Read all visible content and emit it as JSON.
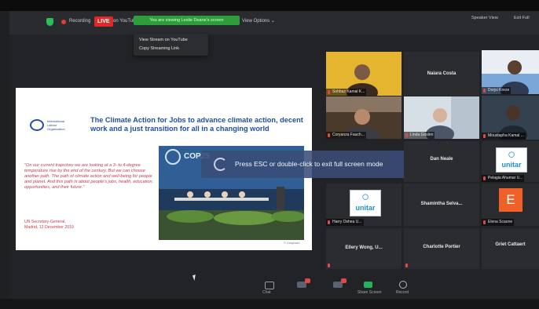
{
  "top_bar": {
    "recording_label": "Recording",
    "live_badge": "LIVE",
    "live_on": "on YouTube",
    "share_banner": "You are viewing Leslie Deane's screen",
    "view_options": "View Options ⌄",
    "speaker_view": "Speaker View",
    "exit_full_screen": "Exit Full"
  },
  "dropdown_menu": {
    "items": [
      "View Stream on YouTube",
      "Copy Streaming Link"
    ]
  },
  "slide": {
    "org_name": "International Labour Organization",
    "title": "The Climate Action for Jobs to advance climate action, decent work and a just transition for all in a changing world",
    "quote": "\"On our current trajectory we are looking at a 3- to 4-degree temperature rise by the end of the century. But we can choose another path. The path of climate action and well-being for people and planet. And this path is about people's jobs, health, education, opportunities, and their future.\"",
    "quote_cite": "UN Secretary-General, Madrid, 12 December 2019",
    "photo_banner": "COP25",
    "photo_caption": "© Unsplash"
  },
  "fullscreen_notice": {
    "text": "Press ESC or double-click to exit full screen mode"
  },
  "participants": [
    {
      "name": "Sohbaz Kamal K...",
      "kind": "video"
    },
    {
      "name": "Naiara Costa",
      "kind": "name"
    },
    {
      "name": "Dorjsi Kreze",
      "kind": "video"
    },
    {
      "name": "Coryanza Fauch...",
      "kind": "video"
    },
    {
      "name": "Linda Goslen",
      "kind": "video"
    },
    {
      "name": "Moustapha Kamal ...",
      "kind": "video"
    },
    {
      "name": "Dan Neale",
      "kind": "name"
    },
    {
      "name": "Pelagia Ahumar U...",
      "kind": "unitar"
    },
    {
      "name": "Harry Oshea U...",
      "kind": "unitar"
    },
    {
      "name": "Shamintha Selva...",
      "kind": "name"
    },
    {
      "name": "Elena Scaone",
      "kind": "letter",
      "letter": "E"
    },
    {
      "name": "Ellery Wong, U...",
      "kind": "name"
    },
    {
      "name": "Charlotte Portier",
      "kind": "name"
    },
    {
      "name": "Griet Cattaert",
      "kind": "name"
    }
  ],
  "unitar_logo": "unitar",
  "toolbar": {
    "share": "Chat",
    "reactions": "Reactions",
    "share_screen": "Share Screen",
    "record": "Record"
  },
  "colors": {
    "live_red": "#e02828",
    "banner_green": "#2e9e3c",
    "slide_title_blue": "#1f4fa3",
    "quote_red": "#c6394d",
    "unitar_blue": "#1f8fce",
    "tile_bg": "#2b2c2f"
  }
}
